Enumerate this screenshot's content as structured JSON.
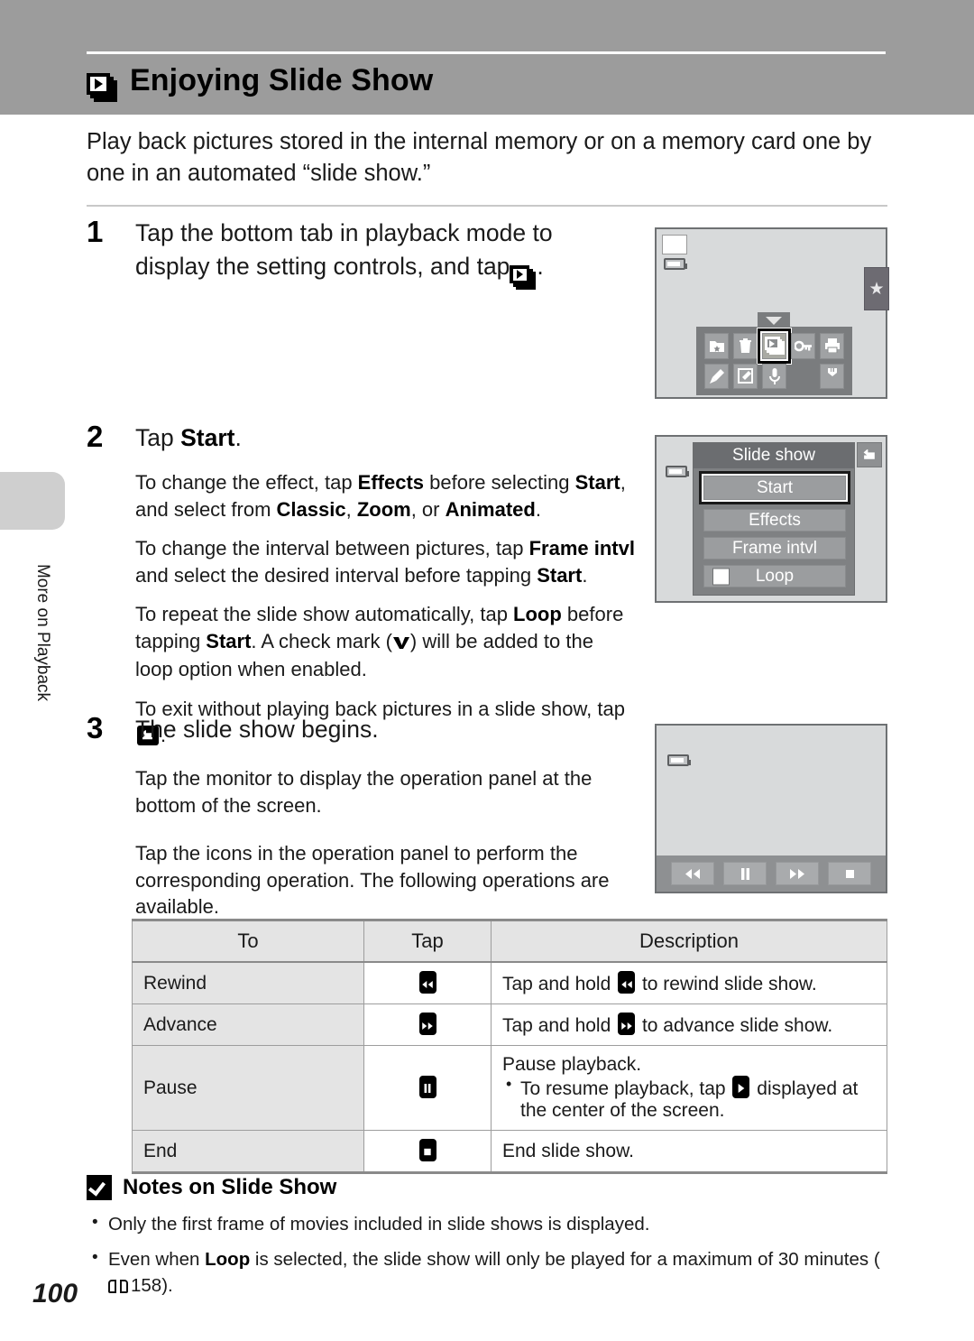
{
  "header": {
    "title": "Enjoying Slide Show",
    "icon": "slideshow-icon"
  },
  "intro": "Play back pictures stored in the internal memory or on a memory card one by one in an automated “slide show.”",
  "sidebar": {
    "label": "More on Playback"
  },
  "page_number": "100",
  "steps": [
    {
      "number": "1",
      "heading_before": "Tap the bottom tab in playback mode to display the setting controls, and tap",
      "heading_after": "."
    },
    {
      "number": "2",
      "heading_before": "Tap ",
      "heading_bold": "Start",
      "heading_after": "."
    },
    {
      "number": "3",
      "heading": "The slide show begins."
    }
  ],
  "step2_body": {
    "p1_a": "To change the effect, tap ",
    "p1_b1": "Effects",
    "p1_c": " before selecting ",
    "p1_b2": "Start",
    "p1_d": ", and select from ",
    "p1_b3": "Classic",
    "p1_e": ", ",
    "p1_b4": "Zoom",
    "p1_f": ", or ",
    "p1_b5": "Animated",
    "p1_g": ".",
    "p2_a": "To change the interval between pictures, tap ",
    "p2_b1": "Frame intvl",
    "p2_c": " and select the desired interval before tapping ",
    "p2_b2": "Start",
    "p2_d": ".",
    "p3_a": "To repeat the slide show automatically, tap ",
    "p3_b1": "Loop",
    "p3_c": " before tapping ",
    "p3_b2": "Start",
    "p3_d": ". A check mark (",
    "p3_e": ") will be added to the loop option when enabled.",
    "p4_a": "To exit without playing back pictures in a slide show, tap ",
    "p4_b": "."
  },
  "step3_body": {
    "p1": "Tap the monitor to display the operation panel at the bottom of the screen.",
    "p2": "Tap the icons in the operation panel to perform the corresponding operation. The following operations are available."
  },
  "screen1": {
    "mode_icon": "playback-mode-icon",
    "battery_icon": "battery-icon",
    "star_tab_icon": "star-icon",
    "grid_icons": [
      "favorites-folder-icon",
      "trash-icon",
      "slideshow-icon",
      "key-lock-icon",
      "print-icon",
      "paint-brush-icon",
      "edit-icon",
      "microphone-icon",
      "wrench-icon"
    ],
    "selected_grid_icon": "slideshow-icon"
  },
  "screen2": {
    "title": "Slide show",
    "items": [
      {
        "label": "Start",
        "selected": true,
        "checkbox": false
      },
      {
        "label": "Effects",
        "selected": false,
        "checkbox": false
      },
      {
        "label": "Frame intvl",
        "selected": false,
        "checkbox": false
      },
      {
        "label": "Loop",
        "selected": false,
        "checkbox": true
      }
    ],
    "back_icon": "back-exit-icon",
    "battery_icon": "battery-icon"
  },
  "screen3": {
    "battery_icon": "battery-icon",
    "op_buttons": [
      "rewind-icon",
      "pause-icon",
      "advance-icon",
      "stop-icon"
    ]
  },
  "table": {
    "headers": [
      "To",
      "Tap",
      "Description"
    ],
    "rows": [
      {
        "to": "Rewind",
        "tap_icon": "rewind-icon",
        "desc_a": "Tap and hold ",
        "desc_icon": "rewind-icon",
        "desc_b": " to rewind slide show."
      },
      {
        "to": "Advance",
        "tap_icon": "advance-icon",
        "desc_a": "Tap and hold ",
        "desc_icon": "advance-icon",
        "desc_b": " to advance slide show."
      },
      {
        "to": "Pause",
        "tap_icon": "pause-icon",
        "desc_line1": "Pause playback.",
        "desc_bullet_a": "To resume playback, tap ",
        "desc_bullet_icon": "play-icon",
        "desc_bullet_b": " displayed at the center of the screen."
      },
      {
        "to": "End",
        "tap_icon": "stop-icon",
        "desc_a": "End slide show.",
        "desc_icon": "",
        "desc_b": ""
      }
    ]
  },
  "notes": {
    "heading": "Notes on Slide Show",
    "heading_icon": "caution-check-icon",
    "items": [
      {
        "a": "Only the first frame of movies included in slide shows is displayed.",
        "b1": "",
        "c": "",
        "ref": ""
      },
      {
        "a": "Even when ",
        "b1": "Loop",
        "c": " is selected, the slide show will only be played for a maximum of 30 minutes (",
        "ref": "158",
        "d": ")."
      }
    ]
  },
  "colors": {
    "header_band": "#9c9c9c",
    "screen_bg": "#d8dadb",
    "panel_gray": "#7a7c7e",
    "table_header": "#e4e4e4"
  }
}
